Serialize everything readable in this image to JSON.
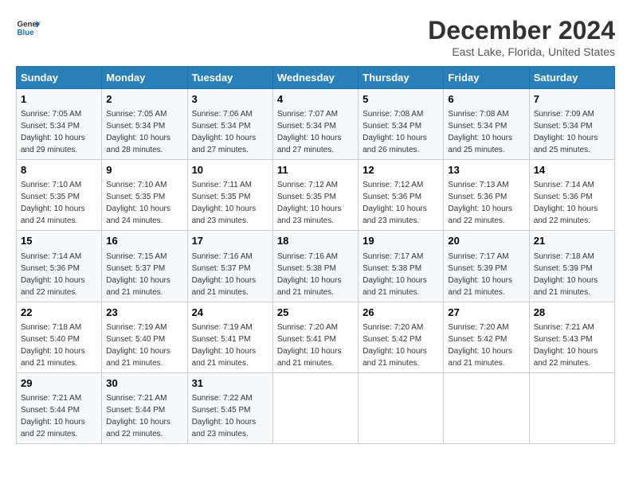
{
  "logo": {
    "line1": "General",
    "line2": "Blue"
  },
  "title": "December 2024",
  "subtitle": "East Lake, Florida, United States",
  "header_colors": {
    "bg": "#2980b9"
  },
  "days_of_week": [
    "Sunday",
    "Monday",
    "Tuesday",
    "Wednesday",
    "Thursday",
    "Friday",
    "Saturday"
  ],
  "weeks": [
    [
      {
        "day": "1",
        "sunrise": "7:05 AM",
        "sunset": "5:34 PM",
        "daylight": "10 hours and 29 minutes."
      },
      {
        "day": "2",
        "sunrise": "7:05 AM",
        "sunset": "5:34 PM",
        "daylight": "10 hours and 28 minutes."
      },
      {
        "day": "3",
        "sunrise": "7:06 AM",
        "sunset": "5:34 PM",
        "daylight": "10 hours and 27 minutes."
      },
      {
        "day": "4",
        "sunrise": "7:07 AM",
        "sunset": "5:34 PM",
        "daylight": "10 hours and 27 minutes."
      },
      {
        "day": "5",
        "sunrise": "7:08 AM",
        "sunset": "5:34 PM",
        "daylight": "10 hours and 26 minutes."
      },
      {
        "day": "6",
        "sunrise": "7:08 AM",
        "sunset": "5:34 PM",
        "daylight": "10 hours and 25 minutes."
      },
      {
        "day": "7",
        "sunrise": "7:09 AM",
        "sunset": "5:34 PM",
        "daylight": "10 hours and 25 minutes."
      }
    ],
    [
      {
        "day": "8",
        "sunrise": "7:10 AM",
        "sunset": "5:35 PM",
        "daylight": "10 hours and 24 minutes."
      },
      {
        "day": "9",
        "sunrise": "7:10 AM",
        "sunset": "5:35 PM",
        "daylight": "10 hours and 24 minutes."
      },
      {
        "day": "10",
        "sunrise": "7:11 AM",
        "sunset": "5:35 PM",
        "daylight": "10 hours and 23 minutes."
      },
      {
        "day": "11",
        "sunrise": "7:12 AM",
        "sunset": "5:35 PM",
        "daylight": "10 hours and 23 minutes."
      },
      {
        "day": "12",
        "sunrise": "7:12 AM",
        "sunset": "5:36 PM",
        "daylight": "10 hours and 23 minutes."
      },
      {
        "day": "13",
        "sunrise": "7:13 AM",
        "sunset": "5:36 PM",
        "daylight": "10 hours and 22 minutes."
      },
      {
        "day": "14",
        "sunrise": "7:14 AM",
        "sunset": "5:36 PM",
        "daylight": "10 hours and 22 minutes."
      }
    ],
    [
      {
        "day": "15",
        "sunrise": "7:14 AM",
        "sunset": "5:36 PM",
        "daylight": "10 hours and 22 minutes."
      },
      {
        "day": "16",
        "sunrise": "7:15 AM",
        "sunset": "5:37 PM",
        "daylight": "10 hours and 21 minutes."
      },
      {
        "day": "17",
        "sunrise": "7:16 AM",
        "sunset": "5:37 PM",
        "daylight": "10 hours and 21 minutes."
      },
      {
        "day": "18",
        "sunrise": "7:16 AM",
        "sunset": "5:38 PM",
        "daylight": "10 hours and 21 minutes."
      },
      {
        "day": "19",
        "sunrise": "7:17 AM",
        "sunset": "5:38 PM",
        "daylight": "10 hours and 21 minutes."
      },
      {
        "day": "20",
        "sunrise": "7:17 AM",
        "sunset": "5:39 PM",
        "daylight": "10 hours and 21 minutes."
      },
      {
        "day": "21",
        "sunrise": "7:18 AM",
        "sunset": "5:39 PM",
        "daylight": "10 hours and 21 minutes."
      }
    ],
    [
      {
        "day": "22",
        "sunrise": "7:18 AM",
        "sunset": "5:40 PM",
        "daylight": "10 hours and 21 minutes."
      },
      {
        "day": "23",
        "sunrise": "7:19 AM",
        "sunset": "5:40 PM",
        "daylight": "10 hours and 21 minutes."
      },
      {
        "day": "24",
        "sunrise": "7:19 AM",
        "sunset": "5:41 PM",
        "daylight": "10 hours and 21 minutes."
      },
      {
        "day": "25",
        "sunrise": "7:20 AM",
        "sunset": "5:41 PM",
        "daylight": "10 hours and 21 minutes."
      },
      {
        "day": "26",
        "sunrise": "7:20 AM",
        "sunset": "5:42 PM",
        "daylight": "10 hours and 21 minutes."
      },
      {
        "day": "27",
        "sunrise": "7:20 AM",
        "sunset": "5:42 PM",
        "daylight": "10 hours and 21 minutes."
      },
      {
        "day": "28",
        "sunrise": "7:21 AM",
        "sunset": "5:43 PM",
        "daylight": "10 hours and 22 minutes."
      }
    ],
    [
      {
        "day": "29",
        "sunrise": "7:21 AM",
        "sunset": "5:44 PM",
        "daylight": "10 hours and 22 minutes."
      },
      {
        "day": "30",
        "sunrise": "7:21 AM",
        "sunset": "5:44 PM",
        "daylight": "10 hours and 22 minutes."
      },
      {
        "day": "31",
        "sunrise": "7:22 AM",
        "sunset": "5:45 PM",
        "daylight": "10 hours and 23 minutes."
      },
      null,
      null,
      null,
      null
    ]
  ],
  "labels": {
    "sunrise": "Sunrise:",
    "sunset": "Sunset:",
    "daylight": "Daylight:"
  }
}
